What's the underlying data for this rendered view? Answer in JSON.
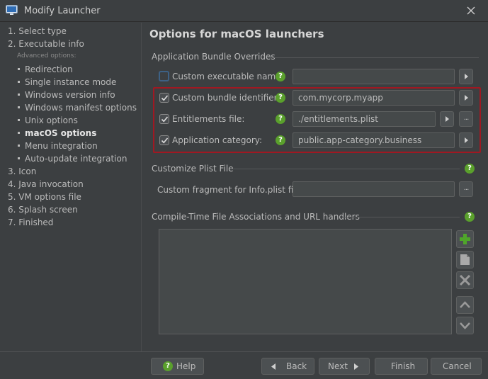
{
  "window": {
    "title": "Modify Launcher"
  },
  "sidebar": {
    "steps": [
      "1. Select type",
      "2. Executable info",
      "3. Icon",
      "4. Java invocation",
      "5. VM options file",
      "6. Splash screen",
      "7. Finished"
    ],
    "advanced_label": "Advanced options:",
    "advanced_items": [
      "Redirection",
      "Single instance mode",
      "Windows version info",
      "Windows manifest options",
      "Unix options",
      "macOS options",
      "Menu integration",
      "Auto-update integration"
    ],
    "active_item": "macOS options"
  },
  "main": {
    "heading": "Options for macOS launchers",
    "bundle_section": "Application Bundle Overrides",
    "rows": [
      {
        "label": "Custom executable name:",
        "checked": false,
        "value": ""
      },
      {
        "label": "Custom bundle identifier:",
        "checked": true,
        "value": "com.mycorp.myapp"
      },
      {
        "label": "Entitlements file:",
        "checked": true,
        "value": "./entitlements.plist"
      },
      {
        "label": "Application category:",
        "checked": true,
        "value": "public.app-category.business"
      }
    ],
    "plist_section": "Customize Plist File",
    "plist_label": "Custom fragment for Info.plist file:",
    "plist_value": "",
    "assoc_section": "Compile-Time File Associations and URL handlers",
    "browse_label": "..."
  },
  "footer": {
    "help": "Help",
    "back": "Back",
    "next": "Next",
    "finish": "Finish",
    "cancel": "Cancel"
  },
  "colors": {
    "background": "#3c3f41",
    "field": "#45494a",
    "help_green": "#5aa02c",
    "highlight_red": "#a01822"
  }
}
